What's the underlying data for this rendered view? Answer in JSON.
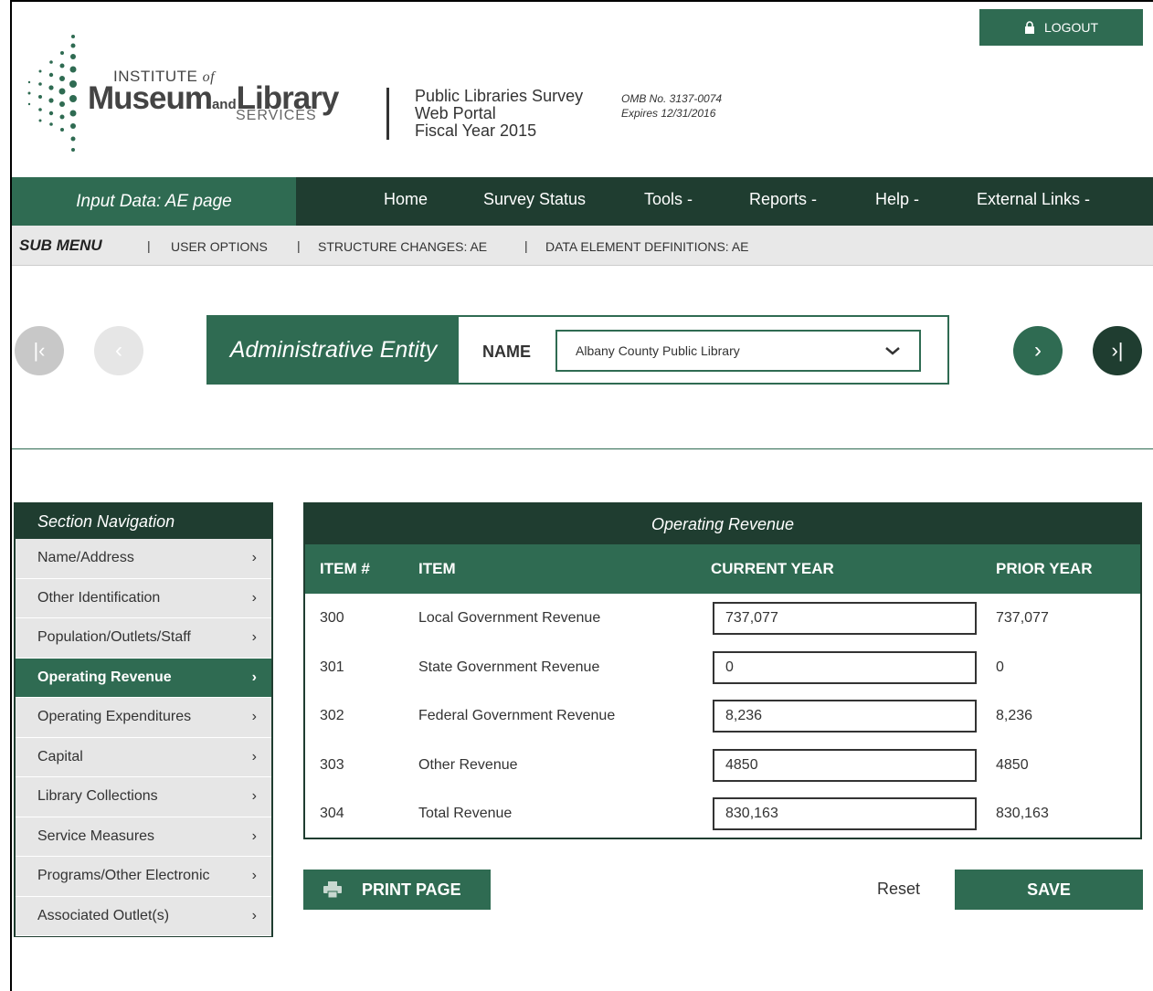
{
  "header": {
    "logout_label": "LOGOUT",
    "logo": {
      "line1": "INSTITUTE",
      "line1_of": "of",
      "museum": "Museum",
      "and": "and",
      "library": "Library",
      "services": "SERVICES"
    },
    "portal": {
      "line1": "Public Libraries Survey",
      "line2": "Web Portal",
      "line3": "Fiscal Year 2015"
    },
    "omb": {
      "line1": "OMB No. 3137-0074",
      "line2": "Expires 12/31/2016"
    }
  },
  "nav": {
    "current_page": "Input Data: AE page",
    "items": [
      "Home",
      "Survey Status",
      "Tools -",
      "Reports -",
      "Help -",
      "External Links -"
    ]
  },
  "submenu": {
    "title": "SUB MENU",
    "items": [
      "USER OPTIONS",
      "STRUCTURE CHANGES: AE",
      "DATA ELEMENT DEFINITIONS: AE"
    ]
  },
  "entity": {
    "label": "Administrative Entity",
    "name_label": "NAME",
    "selected": "Albany County Public Library"
  },
  "section_nav": {
    "title": "Section Navigation",
    "items": [
      "Name/Address",
      "Other Identification",
      "Population/Outlets/Staff",
      "Operating Revenue",
      "Operating Expenditures",
      "Capital",
      "Library Collections",
      "Service Measures",
      "Programs/Other Electronic",
      "Associated Outlet(s)"
    ],
    "active": "Operating Revenue"
  },
  "revenue": {
    "title": "Operating Revenue",
    "headers": {
      "item_no": "ITEM #",
      "item": "ITEM",
      "current": "CURRENT YEAR",
      "prior": "PRIOR YEAR"
    },
    "rows": [
      {
        "no": "300",
        "item": "Local Government Revenue",
        "current": "737,077",
        "prior": "737,077"
      },
      {
        "no": "301",
        "item": "State Government Revenue",
        "current": "0",
        "prior": "0"
      },
      {
        "no": "302",
        "item": "Federal Government Revenue",
        "current": "8,236",
        "prior": "8,236"
      },
      {
        "no": "303",
        "item": "Other Revenue",
        "current": "4850",
        "prior": "4850"
      },
      {
        "no": "304",
        "item": "Total Revenue",
        "current": "830,163",
        "prior": "830,163"
      }
    ]
  },
  "actions": {
    "print": "PRINT PAGE",
    "reset": "Reset",
    "save": "SAVE"
  },
  "colors": {
    "primary": "#2f6b52",
    "dark": "#1f3d30",
    "submenu_bg": "#e8e8e8",
    "nav_item_bg": "#e6e6e6"
  }
}
